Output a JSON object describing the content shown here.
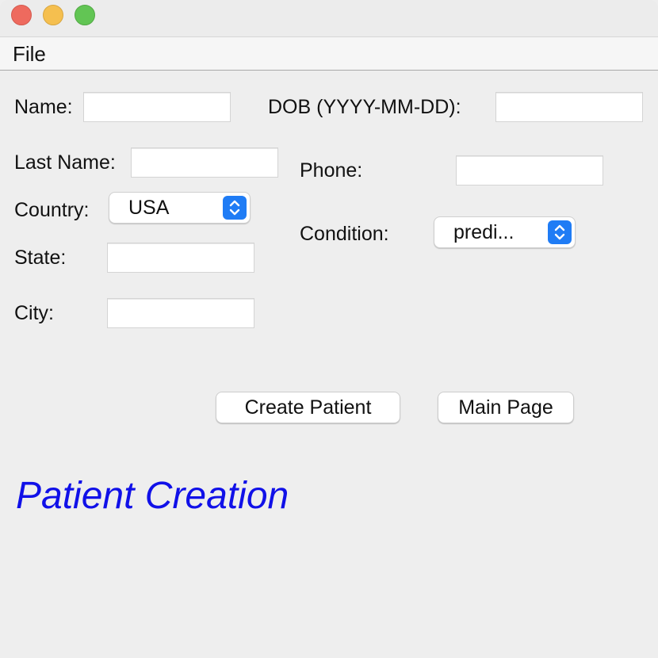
{
  "menubar": {
    "file_label": "File"
  },
  "form": {
    "name_label": "Name:",
    "name_value": "",
    "dob_label": "DOB (YYYY-MM-DD):",
    "dob_value": "",
    "last_name_label": "Last Name:",
    "last_name_value": "",
    "phone_label": "Phone:",
    "phone_value": "",
    "country_label": "Country:",
    "country_selected": "USA",
    "condition_label": "Condition:",
    "condition_selected": "predi...",
    "state_label": "State:",
    "state_value": "",
    "city_label": "City:",
    "city_value": ""
  },
  "buttons": {
    "create_label": "Create Patient",
    "main_label": "Main Page"
  },
  "heading": {
    "text": "Patient Creation",
    "color": "#1010e8"
  },
  "colors": {
    "select_accent": "#1f7cf5",
    "traffic_close": "#ee6a5e",
    "traffic_minimize": "#f5bf4f",
    "traffic_maximize": "#62c554"
  },
  "icons": {
    "window_close": "close-icon",
    "window_minimize": "minimize-icon",
    "window_maximize": "maximize-icon",
    "select_arrows": "chevron-up-down-icon"
  }
}
